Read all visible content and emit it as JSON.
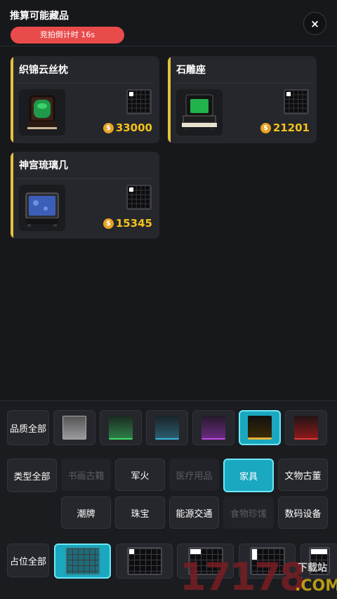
{
  "header": {
    "title": "推算可能藏品",
    "countdown": "竞拍倒计时 16s",
    "close_icon": "×"
  },
  "items": [
    {
      "name": "织锦云丝枕",
      "price": "33000",
      "thumb_color": "#1f9a4a"
    },
    {
      "name": "石雕座",
      "price": "21201",
      "thumb_color": "#22b24c"
    },
    {
      "name": "神宫琉璃几",
      "price": "15345",
      "thumb_color": "#3b5fb8"
    }
  ],
  "coin_icon": "$",
  "filters": {
    "quality_label": "品质全部",
    "quality_swatches": [
      "#8a8a8e",
      "#2e7d46",
      "#2a5d6e",
      "#6a2a80",
      "#e6b23a",
      "#8a1a1a"
    ],
    "type_label": "类型全部",
    "types": [
      {
        "label": "书画古籍",
        "state": "disabled"
      },
      {
        "label": "军火",
        "state": "normal"
      },
      {
        "label": "医疗用品",
        "state": "disabled"
      },
      {
        "label": "家具",
        "state": "active"
      },
      {
        "label": "文物古董",
        "state": "normal"
      },
      {
        "label": "潮牌",
        "state": "normal"
      },
      {
        "label": "珠宝",
        "state": "normal"
      },
      {
        "label": "能源交通",
        "state": "normal"
      },
      {
        "label": "食物珍馐",
        "state": "disabled"
      },
      {
        "label": "数码设备",
        "state": "normal"
      }
    ],
    "slot_label": "占位全部"
  },
  "watermark": {
    "number": "17178",
    "domain": ".COM",
    "site": "下载站"
  }
}
